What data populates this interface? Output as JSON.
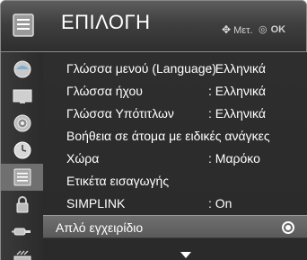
{
  "header": {
    "title": "ΕΠΙΛΟΓΗ",
    "move_hint": "Μετ.",
    "ok_hint": "OK"
  },
  "sidebar": {
    "icons": [
      "picture-icon",
      "screen-icon",
      "audio-icon",
      "clock-icon",
      "option-icon",
      "lock-icon",
      "input-icon",
      "usb-icon"
    ],
    "active_index": 4
  },
  "menu": {
    "items": [
      {
        "label": "Γλώσσα μενού (Language)",
        "value": ": Ελληνικά"
      },
      {
        "label": "Γλώσσα ήχου",
        "value": ": Ελληνικά"
      },
      {
        "label": "Γλώσσα Υπότιτλων",
        "value": ": Ελληνικά"
      },
      {
        "label": "Βοήθεια σε άτομα με ειδικές ανάγκες",
        "value": ""
      },
      {
        "label": "Χώρα",
        "value": ": Μαρόκο"
      },
      {
        "label": "Ετικέτα εισαγωγής",
        "value": ""
      },
      {
        "label": "SIMPLINK",
        "value": ": On"
      },
      {
        "label": "Απλό εγχειρίδιο",
        "value": ""
      }
    ],
    "selected_index": 7
  },
  "colors": {
    "background": "#2b2b2b",
    "selected_row": "#666666",
    "text": "#ffffff"
  }
}
